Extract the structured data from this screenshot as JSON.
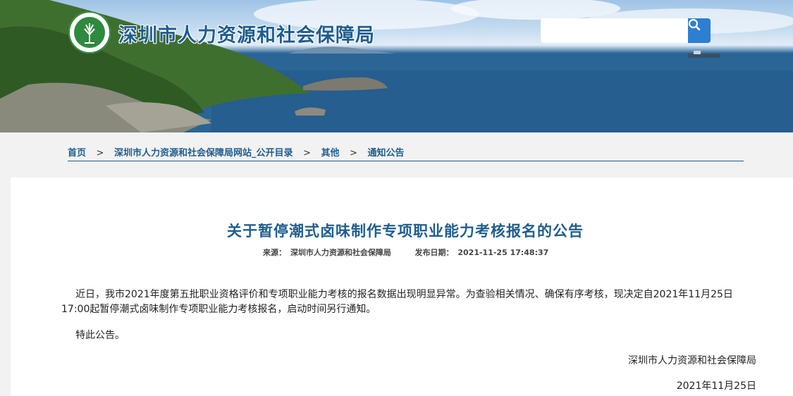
{
  "header": {
    "site_title": "深圳市人力资源和社会保障局",
    "search_placeholder": "",
    "logo_icon": "tree-emblem-icon",
    "search_icon": "search-icon",
    "accent_color": "#1f5d8f",
    "search_button_color": "#2d7fd1"
  },
  "breadcrumb": {
    "items": [
      "首页",
      "深圳市人力资源和社会保障局网站_公开目录",
      "其他",
      "通知公告"
    ],
    "separator": ">"
  },
  "article": {
    "title": "关于暂停潮式卤味制作专项职业能力考核报名的公告",
    "source_label": "来源：",
    "source_value": "深圳市人力资源和社会保障局",
    "date_label": "发布日期：",
    "date_value": "2021-11-25 17:48:37",
    "paragraph_1": "近日，我市2021年度第五批职业资格评价和专项职业能力考核的报名数据出现明显异常。为查验相关情况、确保有序考核，现决定自2021年11月25日17:00起暂停潮式卤味制作专项职业能力考核报名，启动时间另行通知。",
    "paragraph_2": "特此公告。",
    "signer": "深圳市人力资源和社会保障局",
    "sign_date": "2021年11月25日"
  }
}
